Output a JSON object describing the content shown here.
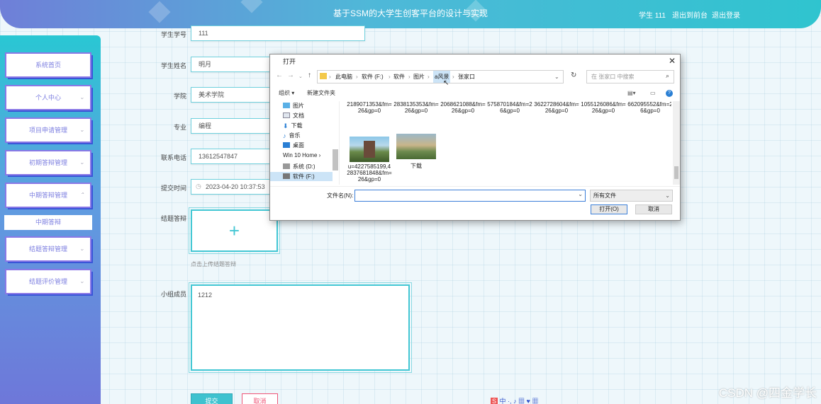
{
  "header": {
    "title": "基于SSM的大学生创客平台的设计与实现",
    "user": "学生 111",
    "back_link": "退出到前台",
    "logout_link": "退出登录"
  },
  "sidebar": {
    "items": [
      {
        "label": "系统首页"
      },
      {
        "label": "个人中心"
      },
      {
        "label": "项目申请管理"
      },
      {
        "label": "初期答辩管理"
      },
      {
        "label": "中期答辩管理"
      },
      {
        "label": "结题答辩管理"
      },
      {
        "label": "结题评价管理"
      }
    ],
    "active_sub": "中期答辩"
  },
  "form": {
    "student_no": {
      "label": "学生学号",
      "value": "111"
    },
    "student_name": {
      "label": "学生姓名",
      "value": "明月"
    },
    "college": {
      "label": "学院",
      "value": "美术学院"
    },
    "major": {
      "label": "专业",
      "value": "编程"
    },
    "phone": {
      "label": "联系电话",
      "value": "13612547847"
    },
    "submit_time": {
      "label": "提交时间",
      "value": "2023-04-20 10:37:53"
    },
    "defense": {
      "label": "结题答辩",
      "hint": "点击上传结题答辩"
    },
    "members": {
      "label": "小组成员",
      "value": "1212"
    },
    "submit_label": "提交",
    "cancel_label": "取消"
  },
  "dialog": {
    "title": "打开",
    "path": [
      "此电脑",
      "软件 (F:)",
      "软件",
      "图片",
      "a风景",
      "张家口"
    ],
    "search_placeholder": "在 张家口 中搜索",
    "organize": "组织 ▾",
    "new_folder": "新建文件夹",
    "tree": [
      "图片",
      "文档",
      "下载",
      "音乐",
      "桌面",
      "Win 10 Home ›",
      "系统 (D:)",
      "软件 (F:)"
    ],
    "files_top": [
      "2189071353&fm=26&gp=0",
      "2838135353&fm=26&gp=0",
      "2068621088&fm=26&gp=0",
      "575870184&fm=26&gp=0",
      "3622728604&fm=26&gp=0",
      "1055126086&fm=26&gp=0",
      "662095552&fm=26&gp=0"
    ],
    "files_bottom": [
      "u=4227585199,42837681848&fm=26&gp=0",
      "下载"
    ],
    "filename_label": "文件名(N):",
    "filetype": "所有文件",
    "open_label": "打开(O)",
    "cancel_label": "取消"
  },
  "watermark": "CSDN @四金学长",
  "colors": {
    "accent": "#43c7d4",
    "menu": "#7d7fe0",
    "header_start": "#6f7fd8",
    "header_end": "#2fc4cf"
  }
}
